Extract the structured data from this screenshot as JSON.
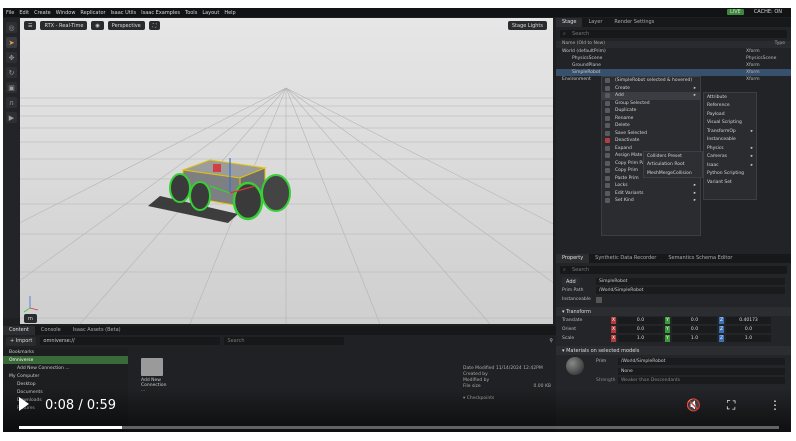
{
  "menubar": {
    "items": [
      "File",
      "Edit",
      "Create",
      "Window",
      "Replicator",
      "Isaac Utils",
      "Isaac Examples",
      "Tools",
      "Layout",
      "Help"
    ],
    "live": "LIVE",
    "cache": "CACHE: ON"
  },
  "viewport": {
    "render_mode": "RTX - Real-Time",
    "camera": "Perspective",
    "stage_lights": "Stage Lights",
    "unit": "m"
  },
  "stage": {
    "tabs": [
      "Stage",
      "Layer",
      "Render Settings"
    ],
    "search_placeholder": "Search",
    "col_name": "Name (Old to New)",
    "col_type": "Type",
    "rows": [
      {
        "name": "World (defaultPrim)",
        "type": "Xform"
      },
      {
        "name": "PhysicsScene",
        "type": "PhysicsScene"
      },
      {
        "name": "GroundPlane",
        "type": "Xform"
      },
      {
        "name": "SimpleRobot",
        "type": "Xform"
      },
      {
        "name": "Environment",
        "type": "Xform"
      }
    ]
  },
  "context_menu": {
    "header": "(SimpleRobot selected & hovered)",
    "items": [
      "Create",
      "Add",
      "Group Selected",
      "Duplicate",
      "Rename",
      "Delete",
      "Save Selected",
      "Deactivate",
      "Expand",
      "Assign Mate",
      "Copy Prim Path",
      "Copy Prim",
      "Paste Prim",
      "Locks",
      "Edit Variants",
      "Set Kind"
    ],
    "sub_expand": [
      "Colliders Preset",
      "Articulation Root",
      "MeshMergeCollision"
    ],
    "sub_add": [
      "Attribute",
      "Reference",
      "Payload",
      "Visual Scripting",
      "TransformOp",
      "Instanceable",
      "Physics",
      "Cameras",
      "Isaac",
      "Python Scripting",
      "Variant Set"
    ]
  },
  "property": {
    "tabs": [
      "Property",
      "Synthetic Data Recorder",
      "Semantics Schema Editor"
    ],
    "search_placeholder": "Search",
    "add_label": "Add",
    "prim_name": "SimpleRobot",
    "prim_path_label": "Prim Path",
    "prim_path": "/World/SimpleRobot",
    "instanceable_label": "Instanceable",
    "transform_label": "Transform",
    "translate_label": "Translate",
    "orient_label": "Orient",
    "scale_label": "Scale",
    "translate": [
      "0.0",
      "0.0",
      "0.40173"
    ],
    "orient": [
      "0.0",
      "0.0",
      "0.0"
    ],
    "scale": [
      "1.0",
      "1.0",
      "1.0"
    ],
    "materials_label": "Materials on selected models",
    "prim_label": "Prim",
    "material_prim": "/World/SimpleRobot",
    "material_value": "None",
    "strength_label": "Strength",
    "strength_value": "Weaker than Descendants"
  },
  "content": {
    "tabs": [
      "Content",
      "Console",
      "Isaac Assets (Beta)"
    ],
    "import_label": "Import",
    "path": "omniverse://",
    "search_placeholder": "Search",
    "tree": [
      "Bookmarks",
      "Omniverse",
      "Add New Connection ...",
      "My Computer",
      "Desktop",
      "Documents",
      "Downloads",
      "Pictures"
    ],
    "folder_label": "Add New Connection ...",
    "date_modified_label": "Date Modified",
    "date_modified": "11/14/2024 12:42PM",
    "created_by_label": "Created by",
    "modified_by_label": "Modified by",
    "file_size_label": "File size",
    "file_size": "0.00 KB",
    "checkpoints_label": "Checkpoints"
  },
  "player": {
    "time": "0:08 / 0:59",
    "progress": 0.136
  }
}
